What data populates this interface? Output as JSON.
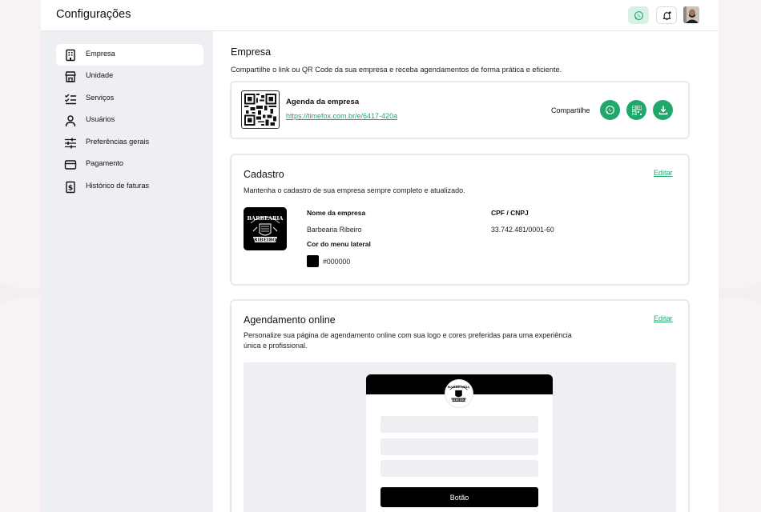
{
  "header": {
    "title": "Configurações"
  },
  "sidebar": {
    "items": [
      {
        "label": "Empresa",
        "icon": "building-icon"
      },
      {
        "label": "Unidade",
        "icon": "store-icon"
      },
      {
        "label": "Serviços",
        "icon": "checklist-icon"
      },
      {
        "label": "Usuários",
        "icon": "user-icon"
      },
      {
        "label": "Preferências gerais",
        "icon": "sliders-icon"
      },
      {
        "label": "Pagamento",
        "icon": "credit-card-icon"
      },
      {
        "label": "Histórico de faturas",
        "icon": "invoice-icon"
      }
    ],
    "active": "Empresa"
  },
  "company": {
    "title": "Empresa",
    "description": "Compartilhe o link ou QR Code da sua empresa e receba agendamentos de forma prática e eficiente.",
    "agenda_title": "Agenda da empresa",
    "agenda_link": "https://timefox.com.br/e/6417-420a",
    "share_label": "Compartilhe"
  },
  "cadastro": {
    "title": "Cadastro",
    "description": "Mantenha o cadastro de sua empresa sempre completo e atualizado.",
    "edit_label": "Editar",
    "company_name_label": "Nome da empresa",
    "company_name": "Barbearia Ribeiro",
    "doc_label": "CPF / CNPJ",
    "doc_value": "33.742.481/0001-60",
    "menu_color_label": "Cor do menu lateral",
    "menu_color": "#000000",
    "logo_text_top": "BARBEARIA",
    "logo_text_bottom": "RIBEIRO"
  },
  "online": {
    "title": "Agendamento online",
    "description_line1": "Personalize sua página de agendamento online com sua logo e cores preferidas para uma experiência",
    "description_line2": "única e profissional.",
    "edit_label": "Editar",
    "preview_button": "Botão"
  },
  "colors": {
    "accent": "#1ea96b",
    "accent_light": "#d8f1e4",
    "sidebar_bg": "#edeff2"
  }
}
